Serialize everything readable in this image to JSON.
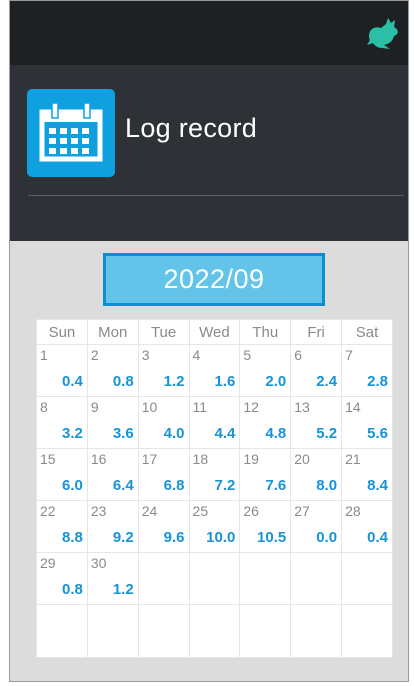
{
  "header": {
    "title": "Log record",
    "app_icon": "rabbit-icon",
    "title_icon": "calendar-icon"
  },
  "colors": {
    "topbar": "#1e2124",
    "header": "#2e3135",
    "accent": "#0fa0e0",
    "value": "#1793d8",
    "month_fill": "#63c3e8",
    "month_border": "#0b8fd1"
  },
  "calendar": {
    "month": "2022/09",
    "weekdays": [
      "Sun",
      "Mon",
      "Tue",
      "Wed",
      "Thu",
      "Fri",
      "Sat"
    ],
    "weeks": [
      [
        {
          "day": "1",
          "value": "0.4"
        },
        {
          "day": "2",
          "value": "0.8"
        },
        {
          "day": "3",
          "value": "1.2"
        },
        {
          "day": "4",
          "value": "1.6"
        },
        {
          "day": "5",
          "value": "2.0"
        },
        {
          "day": "6",
          "value": "2.4"
        },
        {
          "day": "7",
          "value": "2.8"
        }
      ],
      [
        {
          "day": "8",
          "value": "3.2"
        },
        {
          "day": "9",
          "value": "3.6"
        },
        {
          "day": "10",
          "value": "4.0"
        },
        {
          "day": "11",
          "value": "4.4"
        },
        {
          "day": "12",
          "value": "4.8"
        },
        {
          "day": "13",
          "value": "5.2"
        },
        {
          "day": "14",
          "value": "5.6"
        }
      ],
      [
        {
          "day": "15",
          "value": "6.0"
        },
        {
          "day": "16",
          "value": "6.4"
        },
        {
          "day": "17",
          "value": "6.8"
        },
        {
          "day": "18",
          "value": "7.2"
        },
        {
          "day": "19",
          "value": "7.6"
        },
        {
          "day": "20",
          "value": "8.0"
        },
        {
          "day": "21",
          "value": "8.4"
        }
      ],
      [
        {
          "day": "22",
          "value": "8.8"
        },
        {
          "day": "23",
          "value": "9.2"
        },
        {
          "day": "24",
          "value": "9.6"
        },
        {
          "day": "25",
          "value": "10.0"
        },
        {
          "day": "26",
          "value": "10.5"
        },
        {
          "day": "27",
          "value": "0.0"
        },
        {
          "day": "28",
          "value": "0.4"
        }
      ],
      [
        {
          "day": "29",
          "value": "0.8"
        },
        {
          "day": "30",
          "value": "1.2"
        },
        {
          "day": "",
          "value": ""
        },
        {
          "day": "",
          "value": ""
        },
        {
          "day": "",
          "value": ""
        },
        {
          "day": "",
          "value": ""
        },
        {
          "day": "",
          "value": ""
        }
      ],
      [
        {
          "day": "",
          "value": ""
        },
        {
          "day": "",
          "value": ""
        },
        {
          "day": "",
          "value": ""
        },
        {
          "day": "",
          "value": ""
        },
        {
          "day": "",
          "value": ""
        },
        {
          "day": "",
          "value": ""
        },
        {
          "day": "",
          "value": ""
        }
      ]
    ]
  }
}
